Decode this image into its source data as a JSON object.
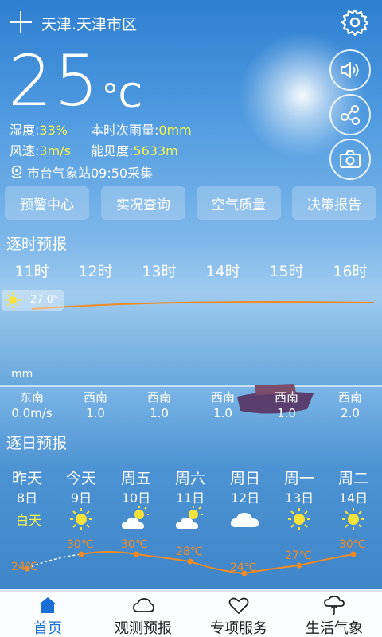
{
  "header": {
    "city": "天津.天津市区"
  },
  "current": {
    "temperature": "25",
    "unit": "°C",
    "humidity_label": "湿度:",
    "humidity": "33%",
    "rain_label": "本时次雨量:",
    "rain": "0mm",
    "wind_label": "风速:",
    "wind": "3m/s",
    "visibility_label": "能见度:",
    "visibility": "5633m",
    "station": "市台气象站09:50采集"
  },
  "quick_buttons": [
    "预警中心",
    "实况查询",
    "空气质量",
    "决策报告"
  ],
  "hourly": {
    "title": "逐时预报",
    "hours": [
      "11时",
      "12时",
      "13时",
      "14时",
      "15时",
      "16时"
    ],
    "temp_badge": "27.0°",
    "precip_unit": "mm",
    "wind_dirs": [
      "东南",
      "西南",
      "西南",
      "西南",
      "西南",
      "西南"
    ],
    "wind_speeds": [
      "0.0m/s",
      "1.0",
      "1.0",
      "1.0",
      "1.0",
      "2.0"
    ]
  },
  "daily": {
    "title": "逐日预报",
    "daytime_label": "白天",
    "days": [
      {
        "name": "昨天",
        "date": "8日",
        "icon": "none",
        "temp": "24℃"
      },
      {
        "name": "今天",
        "date": "9日",
        "icon": "sun-icon",
        "temp": "30℃"
      },
      {
        "name": "周五",
        "date": "10日",
        "icon": "partly-cloudy-icon",
        "temp": "30℃"
      },
      {
        "name": "周六",
        "date": "11日",
        "icon": "partly-cloudy-icon",
        "temp": "28℃"
      },
      {
        "name": "周日",
        "date": "12日",
        "icon": "cloud-icon",
        "temp": "24℃"
      },
      {
        "name": "周一",
        "date": "13日",
        "icon": "sun-icon",
        "temp": "27℃"
      },
      {
        "name": "周二",
        "date": "14日",
        "icon": "sun-icon",
        "temp": "30℃"
      }
    ]
  },
  "tabs": [
    {
      "label": "首页",
      "active": true,
      "icon": "home-icon"
    },
    {
      "label": "观测预报",
      "active": false,
      "icon": "cloud-icon"
    },
    {
      "label": "专项服务",
      "active": false,
      "icon": "heart-icon"
    },
    {
      "label": "生活气象",
      "active": false,
      "icon": "umbrella-cloud-icon"
    }
  ],
  "colors": {
    "accent_yellow": "#f7f34a",
    "curve_orange": "#f08a24",
    "tab_active": "#1a6fd6"
  }
}
